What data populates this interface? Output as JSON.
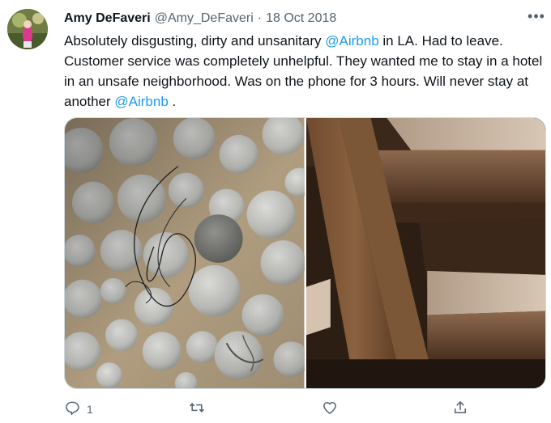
{
  "tweet": {
    "author": {
      "display_name": "Amy DeFaveri",
      "handle": "@Amy_DeFaveri",
      "separator": "·",
      "date": "18 Oct 2018"
    },
    "text": {
      "part1": "Absolutely disgusting, dirty and unsanitary ",
      "mention1": "@Airbnb",
      "part2": " in LA. Had to leave. Customer service was completely unhelpful. They wanted me to stay in a hotel in an unsafe neighborhood. Was on the phone for 3 hours. Will never stay at another ",
      "mention2": "@Airbnb",
      "part3": " ."
    },
    "more_label": "•••",
    "actions": {
      "reply_count": "1",
      "retweet_count": "",
      "like_count": ""
    }
  },
  "colors": {
    "link": "#1d9bf0",
    "secondary_text": "#536471",
    "primary_text": "#0f1419"
  },
  "icons": {
    "more": "more-horizontal-icon",
    "reply": "reply-icon",
    "retweet": "retweet-icon",
    "like": "heart-icon",
    "share": "share-icon"
  }
}
